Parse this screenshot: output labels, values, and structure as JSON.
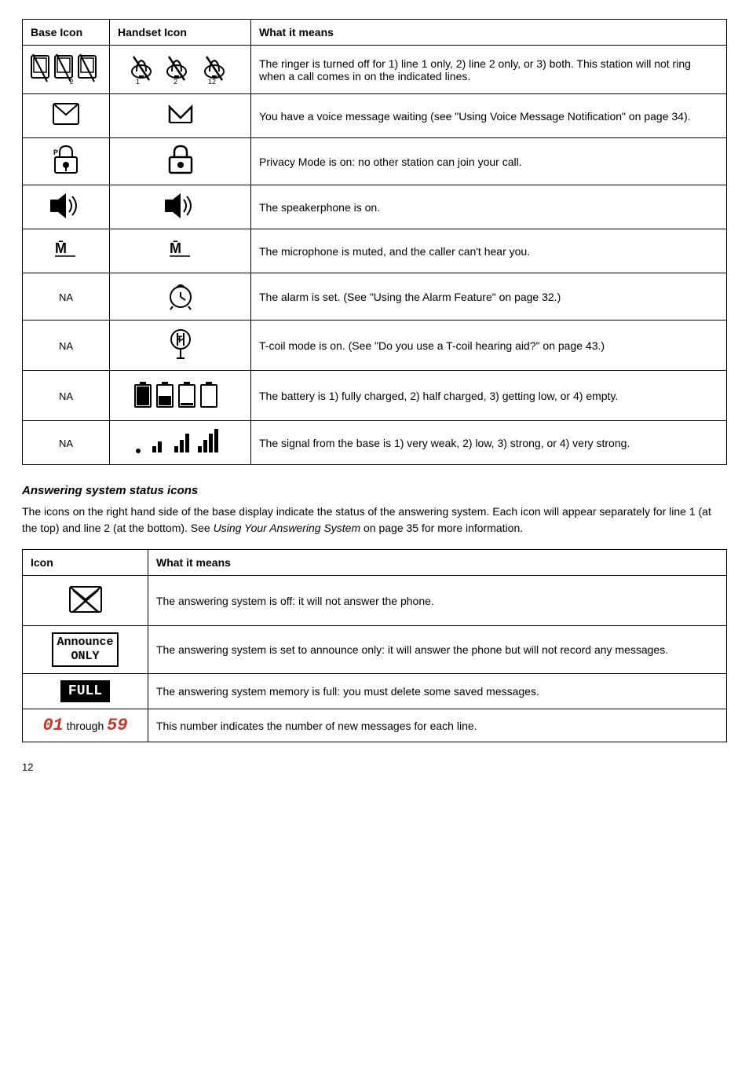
{
  "mainTable": {
    "headers": [
      "Base Icon",
      "Handset Icon",
      "What it means"
    ],
    "rows": [
      {
        "id": "ringer-off",
        "baseIcon": "ringer-off-base",
        "handsetIcon": "ringer-off-handset",
        "description": "The ringer is turned off for 1) line 1 only, 2) line 2 only, or 3) both. This station will not ring when a call comes in on the indicated lines."
      },
      {
        "id": "voice-message",
        "baseIcon": "voice-message-base",
        "handsetIcon": "voice-message-handset",
        "description": "You have a voice message waiting (see \"Using Voice Message Notification\" on page 34)."
      },
      {
        "id": "privacy-mode",
        "baseIcon": "privacy-base",
        "handsetIcon": "privacy-handset",
        "description": "Privacy Mode is on: no other station can join your call."
      },
      {
        "id": "speakerphone",
        "baseIcon": "speakerphone-base",
        "handsetIcon": "speakerphone-handset",
        "description": "The speakerphone is on."
      },
      {
        "id": "mute",
        "baseIcon": "mute-base",
        "handsetIcon": "mute-handset",
        "description": "The microphone is muted, and the caller can't hear you."
      },
      {
        "id": "alarm",
        "baseIcon": "NA",
        "handsetIcon": "alarm-handset",
        "description": "The alarm is set. (See \"Using the Alarm Feature\" on page 32.)"
      },
      {
        "id": "tcoil",
        "baseIcon": "NA",
        "handsetIcon": "tcoil-handset",
        "description": "T-coil mode is on. (See \"Do you use a T-coil hearing aid?\" on page 43.)"
      },
      {
        "id": "battery",
        "baseIcon": "NA",
        "handsetIcon": "battery-handset",
        "description": "The battery is 1) fully charged, 2) half charged, 3) getting low, or 4) empty."
      },
      {
        "id": "signal",
        "baseIcon": "NA",
        "handsetIcon": "signal-handset",
        "description": "The signal from the base is 1) very weak, 2) low, 3) strong, or 4) very strong."
      }
    ]
  },
  "answerSection": {
    "heading": "Answering system status icons",
    "paragraph": "The icons on the right hand side of the base display indicate the status of the answering system. Each icon will appear separately for line 1 (at the top) and line 2 (at the bottom). See Using Your Answering System on page 35 for more information.",
    "italicPhrase": "Using Your Answering System",
    "table": {
      "headers": [
        "Icon",
        "What it means"
      ],
      "rows": [
        {
          "id": "ans-off",
          "icon": "ans-off-icon",
          "description": "The answering system is off: it will not answer the phone."
        },
        {
          "id": "ans-announce",
          "icon": "announce-only-icon",
          "description": "The answering system is set to announce only: it will answer the phone but will not record any messages."
        },
        {
          "id": "ans-full",
          "icon": "full-icon",
          "description": "The answering system memory is full: you must delete some saved messages."
        },
        {
          "id": "ans-count",
          "icon": "msg-count-icon",
          "description": "This number indicates the number of new messages for each line."
        }
      ]
    }
  },
  "pageNumber": "12",
  "labels": {
    "announceOnly": "Announce\nOnly",
    "announceOnlyLine1": "Announce",
    "announceOnlyLine2": "ONLY",
    "full": "FULL",
    "msgCountDisplay": "01 through 59",
    "msgCount01": "01",
    "msgThrough": "through",
    "msgCount59": "59",
    "na": "NA"
  }
}
